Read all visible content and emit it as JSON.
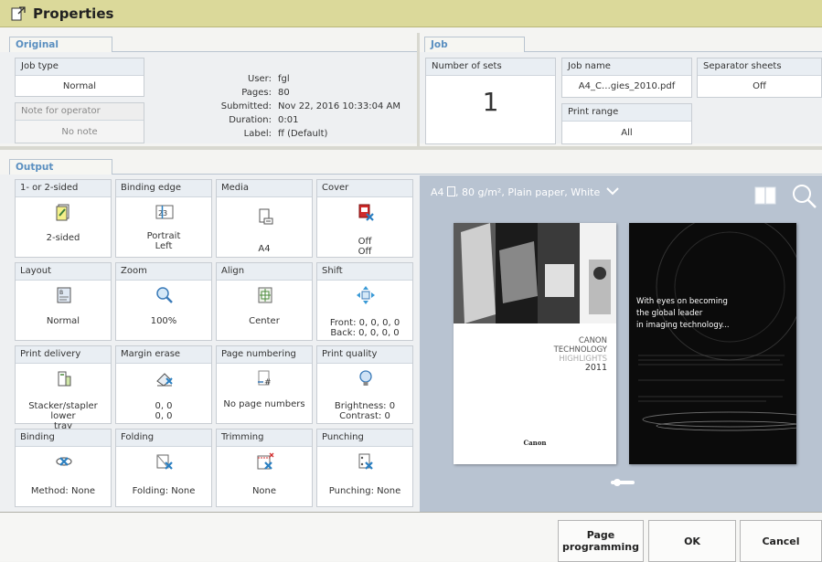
{
  "title": "Properties",
  "original": {
    "tab": "Original",
    "job_type": {
      "label": "Job type",
      "value": "Normal"
    },
    "note": {
      "label": "Note for operator",
      "value": "No note"
    },
    "info": [
      {
        "key": "User:",
        "value": "fgl"
      },
      {
        "key": "Pages:",
        "value": "80"
      },
      {
        "key": "Submitted:",
        "value": "Nov 22, 2016 10:33:04 AM"
      },
      {
        "key": "Duration:",
        "value": "0:01"
      },
      {
        "key": "Label:",
        "value": "ff (Default)"
      }
    ]
  },
  "job": {
    "tab": "Job",
    "sets": {
      "label": "Number of sets",
      "value": "1"
    },
    "name": {
      "label": "Job name",
      "value": "A4_C…gies_2010.pdf"
    },
    "range": {
      "label": "Print range",
      "value": "All"
    },
    "separator": {
      "label": "Separator sheets",
      "value": "Off"
    }
  },
  "output": {
    "tab": "Output",
    "cells": [
      {
        "title": "1- or 2-sided",
        "lines": [
          "2-sided"
        ]
      },
      {
        "title": "Binding edge",
        "lines": [
          "Portrait",
          "Left"
        ]
      },
      {
        "title": "Media",
        "lines": [
          "A4"
        ]
      },
      {
        "title": "Cover",
        "lines": [
          "Off",
          "Off"
        ]
      },
      {
        "title": "Layout",
        "lines": [
          "Normal"
        ]
      },
      {
        "title": "Zoom",
        "lines": [
          "100%"
        ]
      },
      {
        "title": "Align",
        "lines": [
          "Center"
        ]
      },
      {
        "title": "Shift",
        "lines": [
          "Front: 0, 0, 0, 0",
          "Back: 0, 0, 0, 0"
        ]
      },
      {
        "title": "Print delivery",
        "lines": [
          "Stacker/stapler lower",
          "tray"
        ]
      },
      {
        "title": "Margin erase",
        "lines": [
          "0, 0",
          "0, 0"
        ]
      },
      {
        "title": "Page numbering",
        "lines": [
          "No page numbers"
        ]
      },
      {
        "title": "Print quality",
        "lines": [
          "Brightness: 0",
          "Contrast: 0"
        ]
      },
      {
        "title": "Binding",
        "lines": [
          "Method: None"
        ]
      },
      {
        "title": "Folding",
        "lines": [
          "Folding: None"
        ]
      },
      {
        "title": "Trimming",
        "lines": [
          "None"
        ]
      },
      {
        "title": "Punching",
        "lines": [
          "Punching: None"
        ]
      }
    ]
  },
  "preview": {
    "media_text": "A4",
    "media_detail": ", 80 g/m², Plain paper, White",
    "cover_lines": [
      "CANON",
      "TECHNOLOGY",
      "HIGHLIGHTS",
      "2011"
    ],
    "cover_brand": "Canon",
    "back_lines": [
      "With eyes on becoming",
      "the global leader",
      "in imaging technology..."
    ]
  },
  "buttons": {
    "page_programming": "Page programming",
    "ok": "OK",
    "cancel": "Cancel"
  }
}
